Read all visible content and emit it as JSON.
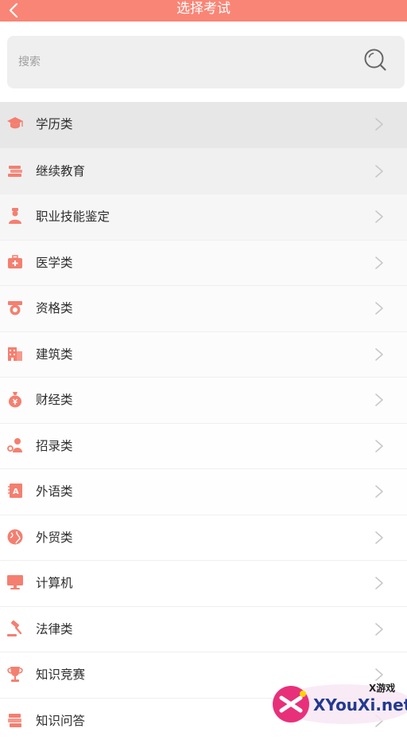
{
  "header": {
    "title": "选择考试",
    "back_icon": "chevron-left-icon"
  },
  "search": {
    "placeholder": "搜索",
    "value": "",
    "icon": "search-icon"
  },
  "categories": [
    {
      "label": "学历类",
      "icon": "graduation-cap-icon",
      "bg": "#e7e7e7"
    },
    {
      "label": "继续教育",
      "icon": "books-icon",
      "bg": "#f0f0f0"
    },
    {
      "label": "职业技能鉴定",
      "icon": "worker-icon",
      "bg": "#f6f6f6"
    },
    {
      "label": "医学类",
      "icon": "medical-kit-icon",
      "bg": "#fafafa"
    },
    {
      "label": "资格类",
      "icon": "badge-icon",
      "bg": "#fbfbfb"
    },
    {
      "label": "建筑类",
      "icon": "building-icon",
      "bg": "#fcfcfc"
    },
    {
      "label": "财经类",
      "icon": "money-bag-icon",
      "bg": "#fdfdfd"
    },
    {
      "label": "招录类",
      "icon": "recruit-icon",
      "bg": "#fefefe"
    },
    {
      "label": "外语类",
      "icon": "language-book-icon",
      "bg": "#fefefe"
    },
    {
      "label": "外贸类",
      "icon": "globe-icon",
      "bg": "#ffffff"
    },
    {
      "label": "计算机",
      "icon": "monitor-icon",
      "bg": "#ffffff"
    },
    {
      "label": "法律类",
      "icon": "gavel-icon",
      "bg": "#ffffff"
    },
    {
      "label": "知识竞赛",
      "icon": "trophy-icon",
      "bg": "#ffffff"
    },
    {
      "label": "知识问答",
      "icon": "qa-book-icon",
      "bg": "#ffffff"
    }
  ],
  "watermark": {
    "line1": "X游戏",
    "line2": "XYouXi.net"
  },
  "colors": {
    "accent": "#f98576",
    "icon": "#f47f70",
    "chevron": "#c8c8c8"
  }
}
